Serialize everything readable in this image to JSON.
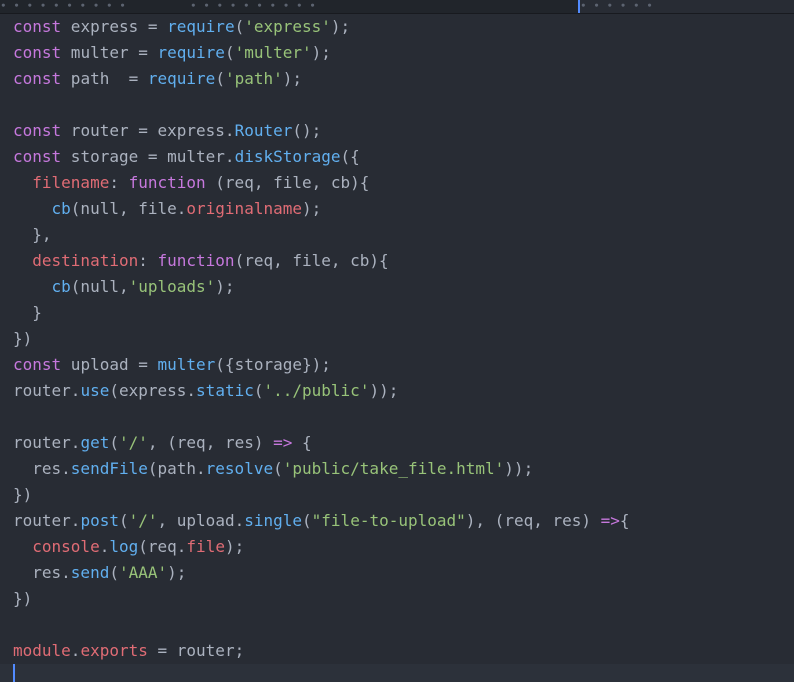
{
  "tabs": {
    "tab1_glyphs": "     ∙ ∙ ∙   ∙  ∙ ∙  ∙ ∙ ∙   ∙",
    "tab2_glyphs": "  ∙  ∙  ∙ ∙    ∙ ∙   ∙  ∙ ∙   ∙",
    "active_glyphs": "        ∙  ∙ ∙  ∙ ∙   ∙"
  },
  "code": [
    [
      [
        "kw",
        "const"
      ],
      [
        "p",
        " express = "
      ],
      [
        "fn",
        "require"
      ],
      [
        "p",
        "("
      ],
      [
        "str",
        "'express'"
      ],
      [
        "p",
        ");"
      ]
    ],
    [
      [
        "kw",
        "const"
      ],
      [
        "p",
        " multer = "
      ],
      [
        "fn",
        "require"
      ],
      [
        "p",
        "("
      ],
      [
        "str",
        "'multer'"
      ],
      [
        "p",
        ");"
      ]
    ],
    [
      [
        "kw",
        "const"
      ],
      [
        "p",
        " path  = "
      ],
      [
        "fn",
        "require"
      ],
      [
        "p",
        "("
      ],
      [
        "str",
        "'path'"
      ],
      [
        "p",
        ");"
      ]
    ],
    [],
    [
      [
        "kw",
        "const"
      ],
      [
        "p",
        " router = express."
      ],
      [
        "fn",
        "Router"
      ],
      [
        "p",
        "();"
      ]
    ],
    [
      [
        "kw",
        "const"
      ],
      [
        "p",
        " storage = multer."
      ],
      [
        "fn",
        "diskStorage"
      ],
      [
        "p",
        "({"
      ]
    ],
    [
      [
        "p",
        "  "
      ],
      [
        "prop",
        "filename"
      ],
      [
        "p",
        ": "
      ],
      [
        "kw",
        "function"
      ],
      [
        "p",
        " (req, file, cb){"
      ]
    ],
    [
      [
        "p",
        "    "
      ],
      [
        "fn",
        "cb"
      ],
      [
        "p",
        "(null, file."
      ],
      [
        "prop",
        "originalname"
      ],
      [
        "p",
        ");"
      ]
    ],
    [
      [
        "p",
        "  },"
      ]
    ],
    [
      [
        "p",
        "  "
      ],
      [
        "prop",
        "destination"
      ],
      [
        "p",
        ": "
      ],
      [
        "kw",
        "function"
      ],
      [
        "p",
        "(req, file, cb){"
      ]
    ],
    [
      [
        "p",
        "    "
      ],
      [
        "fn",
        "cb"
      ],
      [
        "p",
        "(null,"
      ],
      [
        "str",
        "'uploads'"
      ],
      [
        "p",
        ");"
      ]
    ],
    [
      [
        "p",
        "  }"
      ]
    ],
    [
      [
        "p",
        "})"
      ]
    ],
    [
      [
        "kw",
        "const"
      ],
      [
        "p",
        " upload = "
      ],
      [
        "fn",
        "multer"
      ],
      [
        "p",
        "({storage});"
      ]
    ],
    [
      [
        "p",
        "router."
      ],
      [
        "fn",
        "use"
      ],
      [
        "p",
        "(express."
      ],
      [
        "fn",
        "static"
      ],
      [
        "p",
        "("
      ],
      [
        "str",
        "'../public'"
      ],
      [
        "p",
        "));"
      ]
    ],
    [],
    [
      [
        "p",
        "router."
      ],
      [
        "fn",
        "get"
      ],
      [
        "p",
        "("
      ],
      [
        "str",
        "'/'"
      ],
      [
        "p",
        ", (req, res) "
      ],
      [
        "kw",
        "=>"
      ],
      [
        "p",
        " {"
      ]
    ],
    [
      [
        "p",
        "  res."
      ],
      [
        "fn",
        "sendFile"
      ],
      [
        "p",
        "(path."
      ],
      [
        "fn",
        "resolve"
      ],
      [
        "p",
        "("
      ],
      [
        "str",
        "'public/take_file.html'"
      ],
      [
        "p",
        "));"
      ]
    ],
    [
      [
        "p",
        "})"
      ]
    ],
    [
      [
        "p",
        "router."
      ],
      [
        "fn",
        "post"
      ],
      [
        "p",
        "("
      ],
      [
        "str",
        "'/'"
      ],
      [
        "p",
        ", upload."
      ],
      [
        "fn",
        "single"
      ],
      [
        "p",
        "("
      ],
      [
        "str",
        "\"file-to-upload\""
      ],
      [
        "p",
        "), (req, res) "
      ],
      [
        "kw",
        "=>"
      ],
      [
        "p",
        "{"
      ]
    ],
    [
      [
        "p",
        "  "
      ],
      [
        "prop",
        "console"
      ],
      [
        "p",
        "."
      ],
      [
        "fn",
        "log"
      ],
      [
        "p",
        "(req."
      ],
      [
        "prop",
        "file"
      ],
      [
        "p",
        ");"
      ]
    ],
    [
      [
        "p",
        "  res."
      ],
      [
        "fn",
        "send"
      ],
      [
        "p",
        "("
      ],
      [
        "str",
        "'AAA'"
      ],
      [
        "p",
        ");"
      ]
    ],
    [
      [
        "p",
        "})"
      ]
    ],
    [],
    [
      [
        "prop",
        "module"
      ],
      [
        "p",
        "."
      ],
      [
        "prop",
        "exports"
      ],
      [
        "p",
        " = router;"
      ]
    ]
  ]
}
